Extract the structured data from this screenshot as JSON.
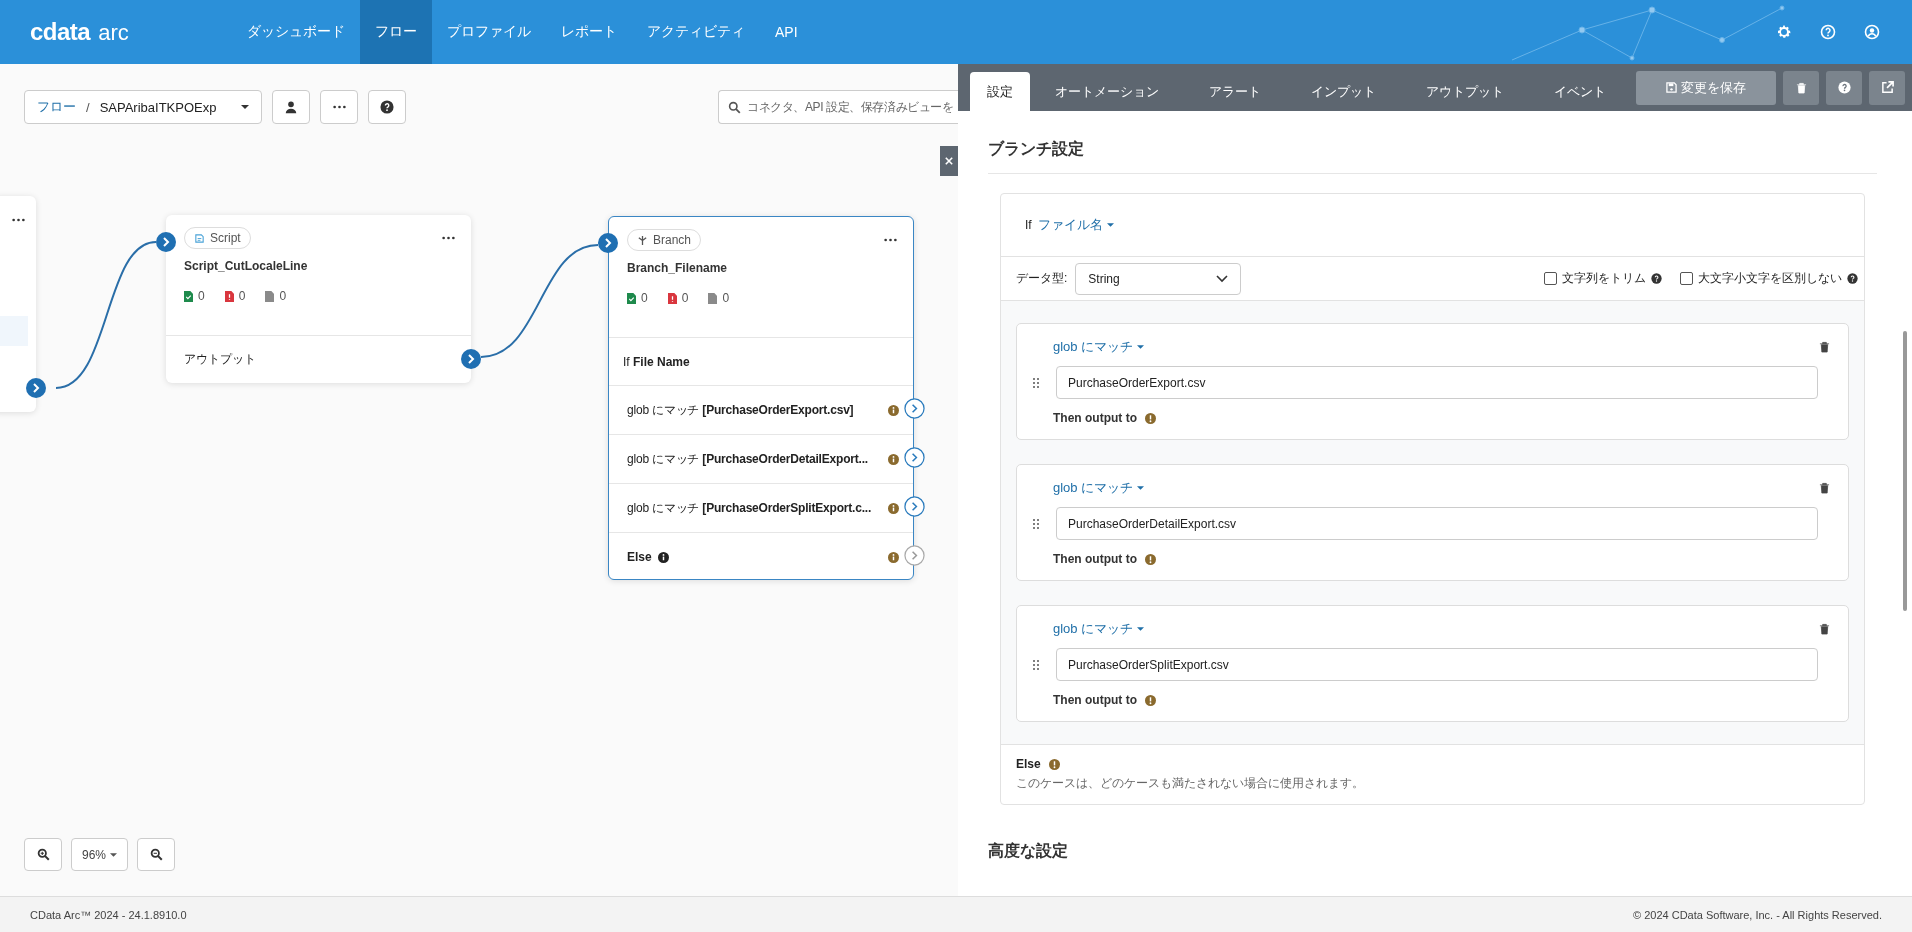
{
  "header": {
    "logo": {
      "brand": "cdata",
      "product": "arc"
    },
    "nav": [
      {
        "label": "ダッシュボード",
        "selected": false
      },
      {
        "label": "フロー",
        "selected": true
      },
      {
        "label": "プロファイル",
        "selected": false
      },
      {
        "label": "レポート",
        "selected": false
      },
      {
        "label": "アクティビティ",
        "selected": false
      },
      {
        "label": "API",
        "selected": false
      }
    ]
  },
  "breadcrumb": {
    "root": "フロー",
    "separator": "/",
    "flow": "SAPAribaITKPOExp"
  },
  "search": {
    "placeholder": "コネクタ、API 設定、保存済みビューを"
  },
  "nodes": [
    {
      "kind": "partial"
    },
    {
      "kind": "script",
      "badge": "Script",
      "name": "Script_CutLocaleLine",
      "counts": [
        "0",
        "0",
        "0"
      ],
      "output": "アウトプット"
    },
    {
      "kind": "branch",
      "badge": "Branch",
      "name": "Branch_Filename",
      "counts": [
        "0",
        "0",
        "0"
      ],
      "condition": {
        "prefix": "If",
        "field": "File Name"
      },
      "cases": [
        "glob にマッチ **[PurchaseOrderExport.csv]**",
        "glob にマッチ **[PurchaseOrderDetailExport...**",
        "glob にマッチ **[PurchaseOrderSplitExport.c...**"
      ],
      "else": "Else"
    }
  ],
  "zoom": {
    "level": "96%"
  },
  "panel": {
    "tabs": [
      {
        "label": "設定",
        "selected": true
      },
      {
        "label": "オートメーション",
        "selected": false
      },
      {
        "label": "アラート",
        "selected": false
      },
      {
        "label": "インプット",
        "selected": false
      },
      {
        "label": "アウトプット",
        "selected": false
      },
      {
        "label": "イベント",
        "selected": false
      }
    ],
    "save": "変更を保存",
    "heading": "ブランチ設定",
    "condition": {
      "prefix": "If",
      "field": "ファイル名"
    },
    "data_type": {
      "label": "データ型:",
      "value": "String"
    },
    "options": [
      {
        "label": "文字列をトリム",
        "checked": false
      },
      {
        "label": "大文字小文字を区別しない",
        "checked": false
      }
    ],
    "cases": [
      {
        "operator": "glob にマッチ",
        "value": "PurchaseOrderExport.csv",
        "then": "Then output to"
      },
      {
        "operator": "glob にマッチ",
        "value": "PurchaseOrderDetailExport.csv",
        "then": "Then output to"
      },
      {
        "operator": "glob にマッチ",
        "value": "PurchaseOrderSplitExport.csv",
        "then": "Then output to"
      }
    ],
    "else": {
      "title": "Else",
      "description": "このケースは、どのケースも満たされない場合に使用されます。"
    },
    "advanced": "高度な設定"
  },
  "footer": {
    "version": "CData Arc™ 2024 - 24.1.8910.0",
    "copyright": "© 2024 CData Software, Inc. - All Rights Reserved."
  }
}
